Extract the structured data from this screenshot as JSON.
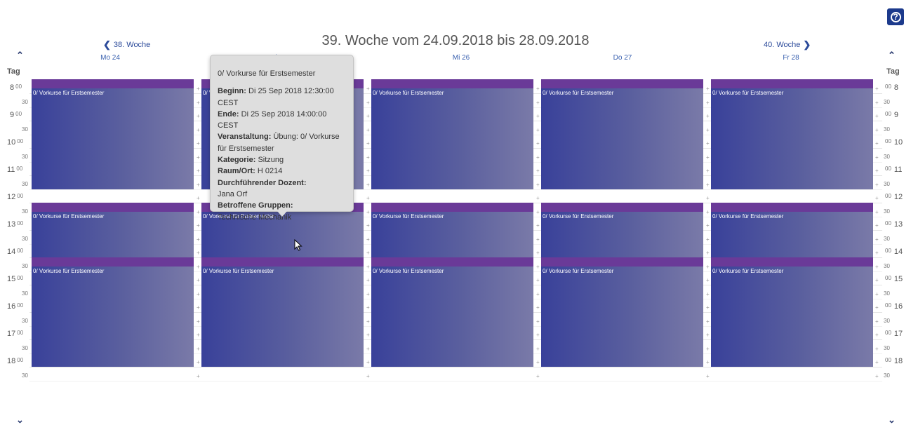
{
  "help": {
    "label": "?"
  },
  "header": {
    "title": "39. Woche vom 24.09.2018 bis 28.09.2018",
    "prev_week": "38. Woche",
    "next_week": "40. Woche",
    "day_label": "Tag"
  },
  "days": [
    "Mo 24",
    "Di 25",
    "Mi 26",
    "Do 27",
    "Fr 28"
  ],
  "hours": [
    "8",
    "9",
    "10",
    "11",
    "12",
    "13",
    "14",
    "15",
    "16",
    "17",
    "18"
  ],
  "minute_full": "00",
  "minute_half": "30",
  "add_symbol": "+",
  "events": [
    {
      "time": "08.00-11.30",
      "title": "0/ Vorkurse für Erstsemester"
    },
    {
      "time": "12.30-14.00",
      "title": "0/ Vorkurse für Erstsemester"
    },
    {
      "time": "14.30-18.00",
      "title": "0/ Vorkurse für Erstsemester"
    }
  ],
  "tooltip": {
    "title": "0/ Vorkurse für Erstsemester",
    "begin_label": "Beginn:",
    "begin_value": "Di 25 Sep 2018 12:30:00 CEST",
    "end_label": "Ende:",
    "end_value": "Di 25 Sep 2018 14:00:00 CEST",
    "event_label": "Veranstaltung:",
    "event_value": "Übung: 0/ Vorkurse für Erstsemester",
    "category_label": "Kategorie:",
    "category_value": "Sitzung",
    "room_label": "Raum/Ort:",
    "room_value": "H 0214",
    "lecturer_label": "Durchführender Dozent:",
    "lecturer_value": "Jana Orf",
    "groups_label": "Betroffene Gruppen:",
    "groups_value": "Technische Mechanik"
  },
  "colors": {
    "event_header": "#6a3a98",
    "event_body": "#39419a",
    "link": "#2b4a9a"
  }
}
